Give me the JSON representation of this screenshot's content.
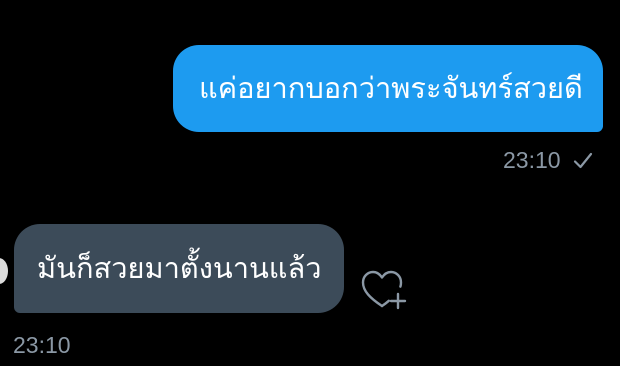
{
  "colors": {
    "background": "#000000",
    "outgoing_bubble": "#1d9bf0",
    "incoming_bubble": "#3c4b59",
    "meta_text": "#8b98a5"
  },
  "messages": [
    {
      "direction": "outgoing",
      "text": "แค่อยากบอกว่าพระจันทร์สวยดี",
      "time": "23:10",
      "status_icon": "check-icon"
    },
    {
      "direction": "incoming",
      "text": "มันก็สวยมาตั้งนานแล้ว",
      "time": "23:10",
      "reaction_icon": "heart-plus-icon"
    }
  ]
}
